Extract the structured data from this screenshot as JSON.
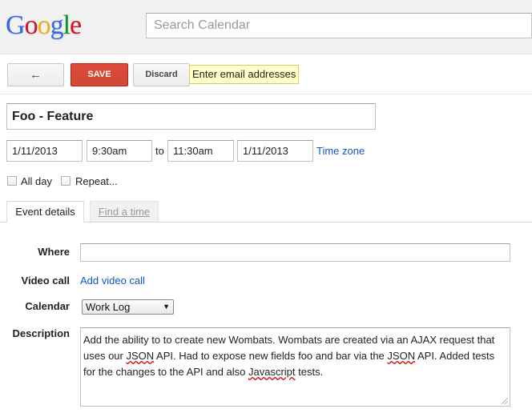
{
  "header": {
    "logo": [
      "G",
      "o",
      "o",
      "g",
      "l",
      "e"
    ],
    "logo_colors": [
      "#3369e8",
      "#d50f25",
      "#eeb211",
      "#3369e8",
      "#009925",
      "#d50f25"
    ],
    "search_placeholder": "Search Calendar"
  },
  "toolbar": {
    "back_icon": "←",
    "save_label": "SAVE",
    "discard_label": "Discard",
    "email_tip": "Enter email addresses"
  },
  "event": {
    "title": "Foo - Feature",
    "start_date": "1/11/2013",
    "start_time": "9:30am",
    "to_label": "to",
    "end_time": "11:30am",
    "end_date": "1/11/2013",
    "timezone_link": "Time zone",
    "all_day_label": "All day",
    "repeat_label": "Repeat...",
    "all_day_checked": false,
    "repeat_checked": false
  },
  "tabs": [
    {
      "label": "Event details",
      "active": true
    },
    {
      "label": "Find a time",
      "active": false
    }
  ],
  "details": {
    "where_label": "Where",
    "where_value": "",
    "video_label": "Video call",
    "video_link": "Add video call",
    "calendar_label": "Calendar",
    "calendar_value": "Work Log",
    "description_label": "Description",
    "description_parts": [
      "Add the ability to to create new Wombats. Wombats are created via an AJAX request that uses our ",
      "JSON",
      " API. Had to expose new fields foo and bar via the ",
      "JSON",
      " API. Added tests for the changes to the API and also ",
      "Javascript",
      " tests."
    ]
  },
  "colors": {
    "save_red": "#d14836",
    "link_blue": "#1155cc",
    "tip_yellow": "#ffffc7"
  }
}
